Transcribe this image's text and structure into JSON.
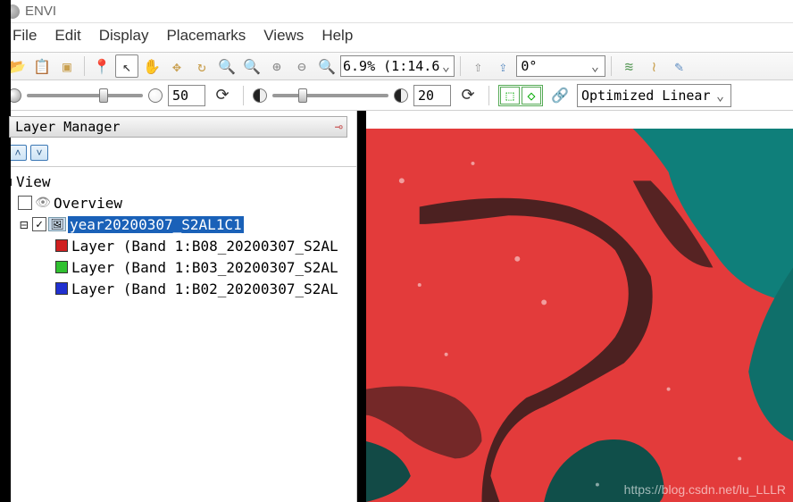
{
  "app": {
    "title": "ENVI"
  },
  "menu": {
    "items": [
      "File",
      "Edit",
      "Display",
      "Placemarks",
      "Views",
      "Help"
    ]
  },
  "toolbar1": {
    "icons": {
      "open": "📂",
      "paste": "📋",
      "crop": "▣",
      "pin": "📍",
      "cursor": "↖",
      "pan": "✋",
      "roi": "✥",
      "rotate": "↻",
      "zoomreset": "🔍",
      "zoomfit": "🔍",
      "zoomin": "⊕",
      "zoomout": "⊖",
      "zoom1": "🔍"
    },
    "zoom_text": "6.9% (1:14.6",
    "nav_up": "⇧",
    "nav_to": "⇪",
    "rotation_text": "0°",
    "spectral": "≋",
    "wave": "≀",
    "measure": "✎"
  },
  "toolbar2": {
    "brightness_value": "50",
    "contrast_value": "20",
    "stretch_text": "Optimized Linear"
  },
  "layermgr": {
    "title": "  Layer Manager"
  },
  "tree": {
    "root": "View",
    "overview": "Overview",
    "dataset": "year20200307_S2AL1C1",
    "layers": [
      "Layer (Band 1:B08_20200307_S2AL",
      "Layer (Band 1:B03_20200307_S2AL",
      "Layer (Band 1:B02_20200307_S2AL"
    ],
    "colors": [
      "#d02020",
      "#30c030",
      "#2030d0"
    ]
  },
  "watermark": "https://blog.csdn.net/lu_LLLR"
}
